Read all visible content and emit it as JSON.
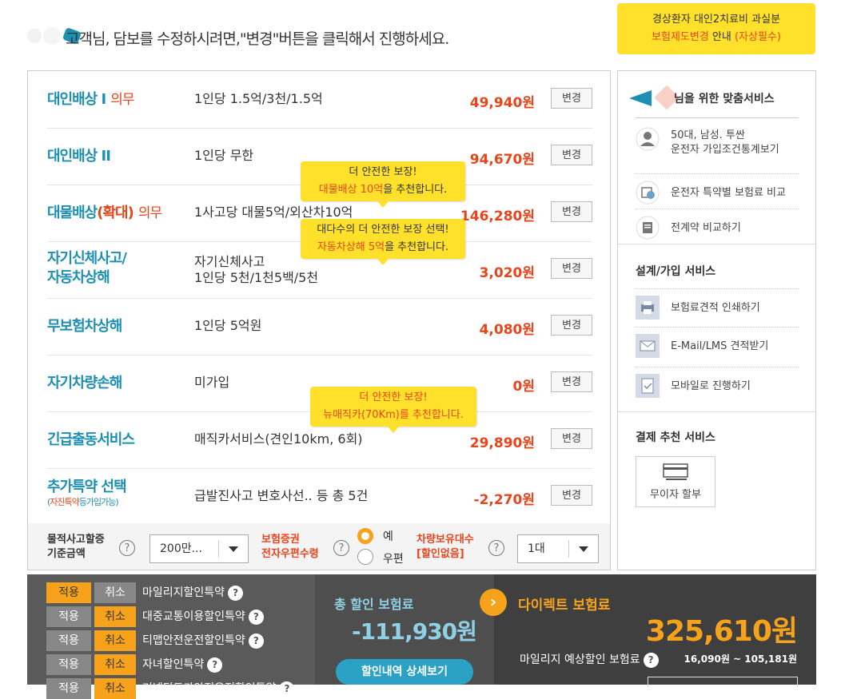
{
  "header": {
    "message": "고객님, 담보를 수정하시려면,\"변경\"버튼을 클릭해서 진행하세요.",
    "notice_line1": "경상환자 대인2치료비 과실분",
    "notice_line2_red": "보험제도변경",
    "notice_line2_mid": " 안내 ",
    "notice_line2_tail": "(자상필수)"
  },
  "coverage": [
    {
      "name": "대인배상 I",
      "tag": "의무",
      "desc": "1인당 1.5억/3천/1.5억",
      "price": "49,940원",
      "button": "변경"
    },
    {
      "name": "대인배상 II",
      "tag": "",
      "desc": "1인당 무한",
      "price": "94,670원",
      "button": "변경"
    },
    {
      "name_main": "대물배상",
      "name_hl": "(확대)",
      "tag": "의무",
      "desc": "1사고당 대물5억/외산차10억",
      "price": "146,280원",
      "button": "변경"
    },
    {
      "name_l1": "자기신체사고/",
      "name_l2": "자동차상해",
      "desc_l1": "자기신체사고",
      "desc_l2": "1인당 5천/1천5백/5천",
      "price": "3,020원",
      "button": "변경"
    },
    {
      "name": "무보험차상해",
      "desc": "1인당 5억원",
      "price": "4,080원",
      "button": "변경"
    },
    {
      "name": "자기차량손해",
      "desc": "미가입",
      "price": "0원",
      "button": "변경"
    },
    {
      "name": "긴급출동서비스",
      "desc": "매직카서비스(견인10km, 6회)",
      "price": "29,890원",
      "button": "변경"
    },
    {
      "name": "추가특약 선택",
      "sub_pre": "(",
      "sub_red": "자진특약",
      "sub_post": "등가입가능)",
      "desc": "급발진사고 변호사선.. 등 총 5건",
      "price": "-2,270원",
      "button": "변경"
    }
  ],
  "tooltips": {
    "t1_l1": "더 안전한 보장!",
    "t1_red": "대물배상 10억",
    "t1_tail": "을 추천합니다.",
    "t2_l1": "대다수의 더 안전한 보장 선택!",
    "t2_red": "자동차상해 5억",
    "t2_tail": "을 추천합니다.",
    "t3_l1": "더 안전한 보장!",
    "t3_red": "뉴매직카(70Km)를 추천합니다."
  },
  "options": {
    "property_label_l1": "물적사고할증",
    "property_label_l2": "기준금액",
    "property_value": "200만...",
    "cert_label_l1": "보험증권",
    "cert_label_l2": "전자우편수령",
    "radio_yes": "예",
    "radio_mail": "우편",
    "vehicle_label_l1": "차량보유대수",
    "vehicle_label_l2": "[할인없음]",
    "vehicle_value": "1대",
    "help": "?"
  },
  "side": {
    "title_tail": "님을 위한 맞춤서비스",
    "profile_l1": "50대, 남성. 투싼",
    "profile_l2": "운전자 가입조건통계보기",
    "compare_rider": "운전자 특약별 보험료 비교",
    "compare_all": "전계약 비교하기",
    "design_title": "설계/가입 서비스",
    "print": "보험료견적 인쇄하기",
    "email": "E-Mail/LMS 견적받기",
    "mobile": "모바일로 진행하기",
    "payment_title": "결제 추천 서비스",
    "installment": "무이자 할부"
  },
  "discounts": [
    {
      "apply": "적용",
      "cancel": "취소",
      "label": "마일리지할인특약",
      "active": "apply"
    },
    {
      "apply": "적용",
      "cancel": "취소",
      "label": "대중교통이용할인특약",
      "active": "cancel"
    },
    {
      "apply": "적용",
      "cancel": "취소",
      "label": "티맵안전운전할인특약",
      "active": "cancel"
    },
    {
      "apply": "적용",
      "cancel": "취소",
      "label": "자녀할인특약",
      "active": "cancel"
    },
    {
      "apply": "적용",
      "cancel": "취소",
      "label": "커넥티드카안전운전할인특약",
      "active": "cancel"
    }
  ],
  "totals": {
    "discount_title": "총 할인 보험료",
    "discount_amount": "-111,930원",
    "detail_button": "할인내역 상세보기",
    "direct_title": "다이렉트 보험료",
    "direct_amount": "325,610원",
    "mileage_label": "마일리지 예상할인 보험료",
    "mileage_range": "16,090원 ~ 105,181원"
  },
  "colors": {
    "accent": "#e8451c",
    "teal": "#1c8fb3",
    "yellow": "#ffe02b",
    "orange": "#f7a21b"
  }
}
